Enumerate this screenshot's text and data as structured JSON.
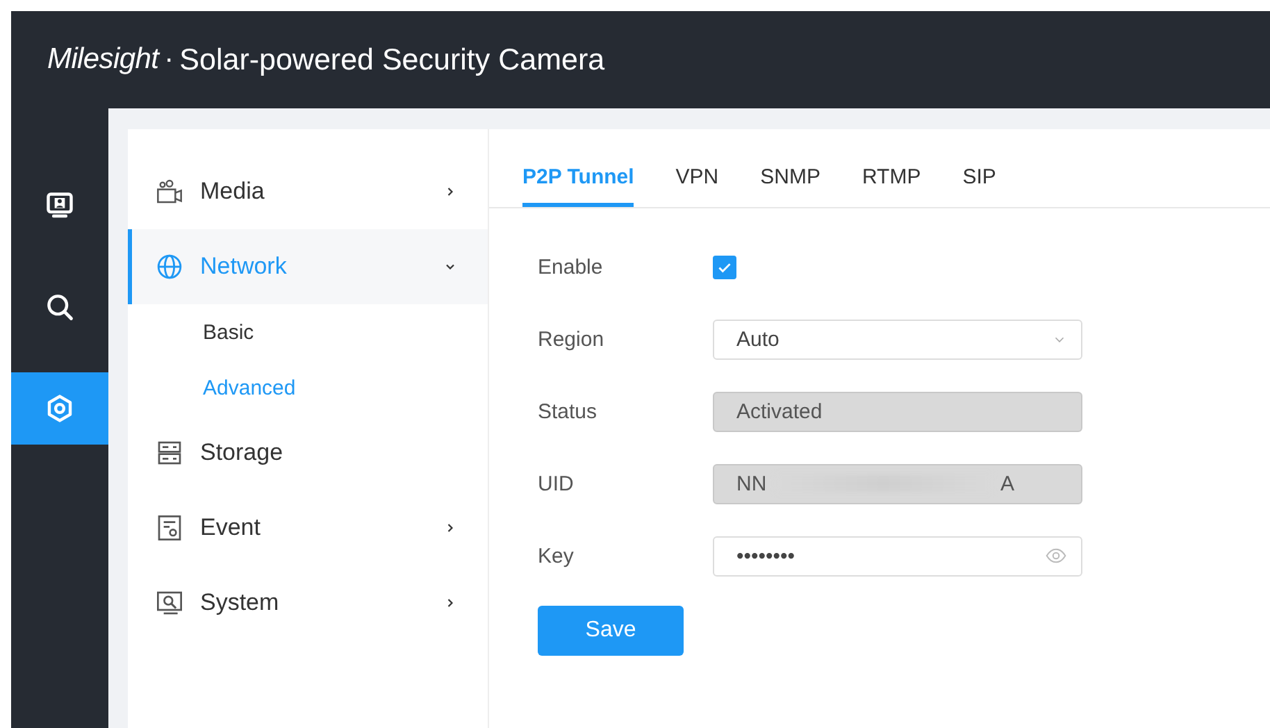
{
  "header": {
    "logo": "Milesight",
    "separator": "·",
    "title": "Solar-powered Security Camera"
  },
  "rail": [
    {
      "kind": "monitor",
      "selected": false
    },
    {
      "kind": "search",
      "selected": false
    },
    {
      "kind": "settings",
      "selected": true
    }
  ],
  "menu": [
    {
      "label": "Media",
      "kind": "camera",
      "has_children": true,
      "expanded": false,
      "selected": false
    },
    {
      "label": "Network",
      "kind": "globe",
      "has_children": true,
      "expanded": true,
      "selected": true,
      "children": [
        {
          "label": "Basic",
          "selected": false
        },
        {
          "label": "Advanced",
          "selected": true
        }
      ]
    },
    {
      "label": "Storage",
      "kind": "storage",
      "has_children": false,
      "expanded": false,
      "selected": false
    },
    {
      "label": "Event",
      "kind": "event",
      "has_children": true,
      "expanded": false,
      "selected": false
    },
    {
      "label": "System",
      "kind": "system",
      "has_children": true,
      "expanded": false,
      "selected": false
    }
  ],
  "tabs": [
    {
      "label": "P2P Tunnel",
      "selected": true
    },
    {
      "label": "VPN",
      "selected": false
    },
    {
      "label": "SNMP",
      "selected": false
    },
    {
      "label": "RTMP",
      "selected": false
    },
    {
      "label": "SIP",
      "selected": false
    }
  ],
  "form": [
    {
      "label": "Enable",
      "kind": "checkbox",
      "checked": true
    },
    {
      "label": "Region",
      "kind": "select",
      "value": "Auto"
    },
    {
      "label": "Status",
      "kind": "readonly",
      "value": "Activated"
    },
    {
      "label": "UID",
      "kind": "masked",
      "value_start": "NN",
      "value_end": "A"
    },
    {
      "label": "Key",
      "kind": "password",
      "value": "••••••••"
    }
  ],
  "save_button": "Save"
}
